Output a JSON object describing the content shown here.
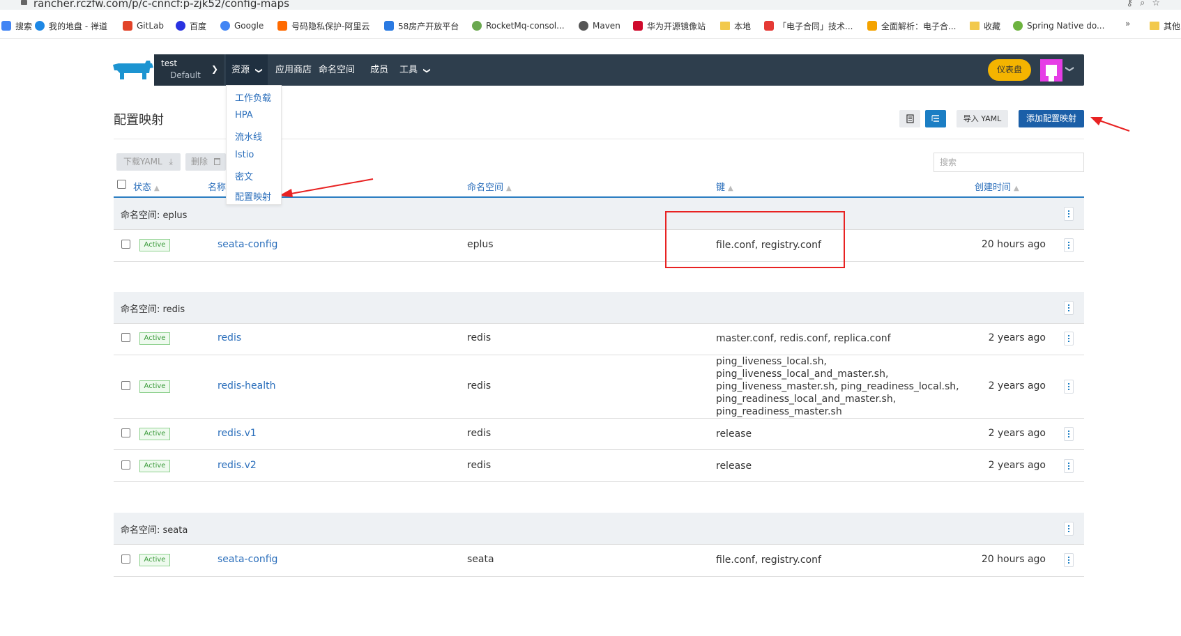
{
  "browser": {
    "url": "rancher.rczfw.com/p/c-cnncf:p-zjk52/config-maps",
    "bookmarks": [
      {
        "label": "搜索",
        "color": "#4285f4"
      },
      {
        "label": "我的地盘 - 禅道",
        "color": "#1e88e5"
      },
      {
        "label": "GitLab",
        "color": "#e24329"
      },
      {
        "label": "百度",
        "color": "#2932e1"
      },
      {
        "label": "Google",
        "color": "#4285f4"
      },
      {
        "label": "号码隐私保护-阿里云",
        "color": "#ff6a00"
      },
      {
        "label": "58房产开放平台",
        "color": "#2a7ae2"
      },
      {
        "label": "RocketMq-consol...",
        "color": "#6aa84f"
      },
      {
        "label": "Maven",
        "color": "#555555"
      },
      {
        "label": "华为开源镜像站",
        "color": "#cf0a2c"
      },
      {
        "label": "本地",
        "color": "#f2c94c"
      },
      {
        "label": "「电子合同」技术...",
        "color": "#e53935"
      },
      {
        "label": "全面解析：电子合...",
        "color": "#f4a300"
      },
      {
        "label": "收藏",
        "color": "#f2c94c"
      },
      {
        "label": "Spring Native do...",
        "color": "#6db33f"
      },
      {
        "label": "其他",
        "color": "#f2c94c"
      }
    ],
    "more": "»"
  },
  "header": {
    "cluster_name": "test",
    "project_name": "Default",
    "nav": [
      "资源",
      "应用商店",
      "命名空间",
      "成员",
      "工具"
    ],
    "dashboard": "仪表盘"
  },
  "dropdown": [
    "工作负载",
    "HPA",
    "流水线",
    "Istio",
    "密文",
    "配置映射"
  ],
  "page": {
    "title": "配置映射",
    "import_yaml": "导入 YAML",
    "add_button": "添加配置映射",
    "download_yaml": "下载YAML",
    "delete": "删除",
    "search_placeholder": "搜索"
  },
  "table": {
    "headers": [
      "状态",
      "名称",
      "命名空间",
      "键",
      "创建时间"
    ],
    "groups": [
      {
        "label": "命名空间: eplus",
        "rows": [
          {
            "status": "Active",
            "name": "seata-config",
            "namespace": "eplus",
            "keys": "file.conf, registry.conf",
            "created": "20 hours ago"
          }
        ]
      },
      {
        "label": "命名空间: redis",
        "rows": [
          {
            "status": "Active",
            "name": "redis",
            "namespace": "redis",
            "keys": "master.conf, redis.conf, replica.conf",
            "created": "2 years ago"
          },
          {
            "status": "Active",
            "name": "redis-health",
            "namespace": "redis",
            "keys": "ping_liveness_local.sh,\nping_liveness_local_and_master.sh,\nping_liveness_master.sh, ping_readiness_local.sh,\nping_readiness_local_and_master.sh,\nping_readiness_master.sh",
            "created": "2 years ago"
          },
          {
            "status": "Active",
            "name": "redis.v1",
            "namespace": "redis",
            "keys": "release",
            "created": "2 years ago"
          },
          {
            "status": "Active",
            "name": "redis.v2",
            "namespace": "redis",
            "keys": "release",
            "created": "2 years ago"
          }
        ]
      },
      {
        "label": "命名空间: seata",
        "rows": [
          {
            "status": "Active",
            "name": "seata-config",
            "namespace": "seata",
            "keys": "file.conf, registry.conf",
            "created": "20 hours ago"
          }
        ]
      }
    ]
  },
  "colors": {
    "header_bg": "#2e3e4d",
    "accent_blue": "#2a6ebb",
    "primary_button": "#1b5fa8",
    "dashboard_button": "#f4b400",
    "active_badge": "#3a9a3a",
    "annotation_red": "#e82222"
  }
}
